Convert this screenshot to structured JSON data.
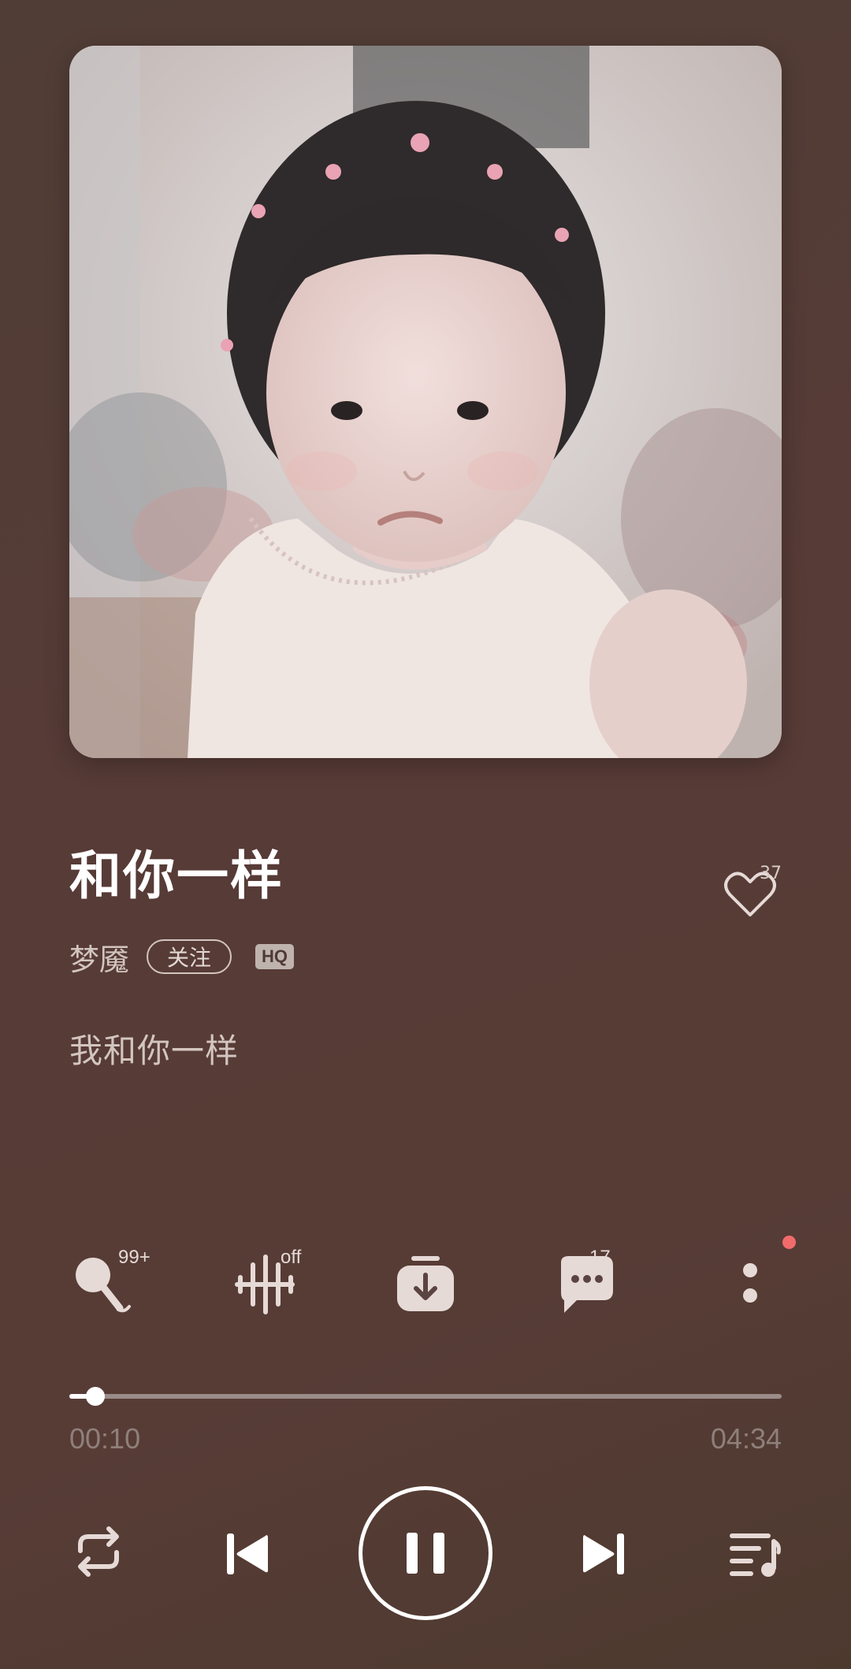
{
  "song": {
    "title": "和你一样",
    "artist": "梦魇",
    "follow_label": "关注",
    "quality_badge": "HQ",
    "lyric_line": "我和你一样",
    "like_count": "37",
    "cover_icon": "album-cover-photo"
  },
  "actions": {
    "karaoke": {
      "icon": "microphone-icon",
      "badge": "99+"
    },
    "sound_effect": {
      "icon": "equalizer-icon",
      "badge": "off"
    },
    "download": {
      "icon": "download-icon",
      "badge": ""
    },
    "comments": {
      "icon": "comment-icon",
      "badge": "17"
    },
    "more": {
      "icon": "more-vertical-icon",
      "has_notification": true
    }
  },
  "progress": {
    "current": "00:10",
    "total": "04:34",
    "fraction": 0.037
  },
  "controls": {
    "repeat": "repeat-icon",
    "previous": "previous-track-icon",
    "play_pause": "pause-icon",
    "next": "next-track-icon",
    "playlist": "playlist-icon"
  },
  "colors": {
    "background": "#573b37",
    "accent": "#ffffff",
    "notification": "#f16b6b"
  }
}
